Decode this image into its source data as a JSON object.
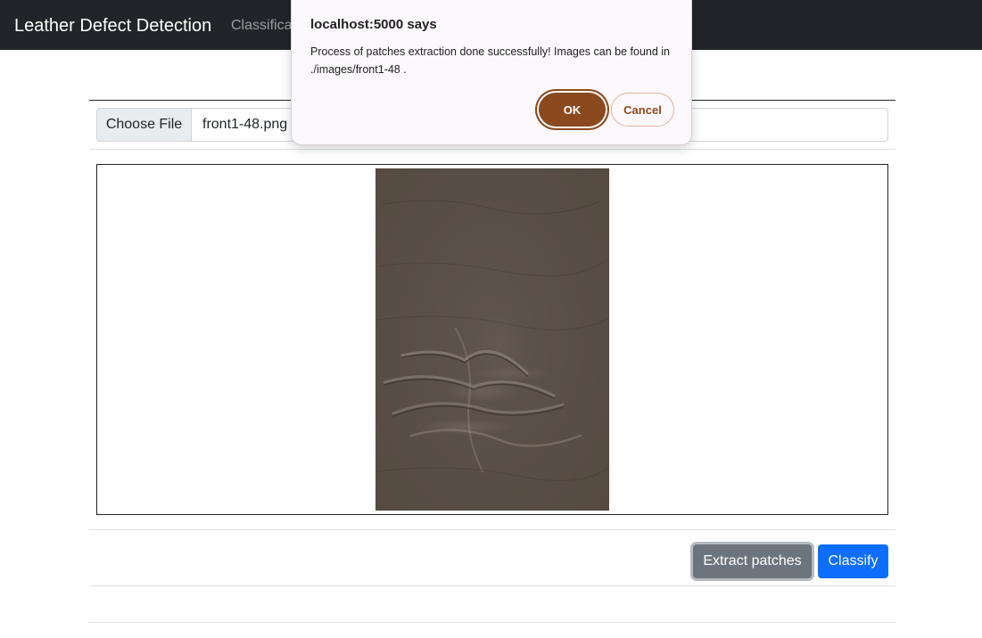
{
  "navbar": {
    "brand": "Leather Defect Detection",
    "link": "Classificati"
  },
  "file_input": {
    "button_label": "Choose File",
    "file_name": "front1-48.png"
  },
  "preview": {
    "image_name": "leather-sample-image"
  },
  "actions": {
    "extract_label": "Extract patches",
    "classify_label": "Classify"
  },
  "dialog": {
    "title": "localhost:5000 says",
    "message": "Process of patches extraction done successfully! Images can be found in ./images/front1-48 .",
    "ok_label": "OK",
    "cancel_label": "Cancel"
  },
  "colors": {
    "navbar": "#212529",
    "primary": "#0d6efd",
    "secondary": "#6c757d",
    "dialog_accent": "#8b4a1e",
    "leather": "#5a4f47"
  }
}
